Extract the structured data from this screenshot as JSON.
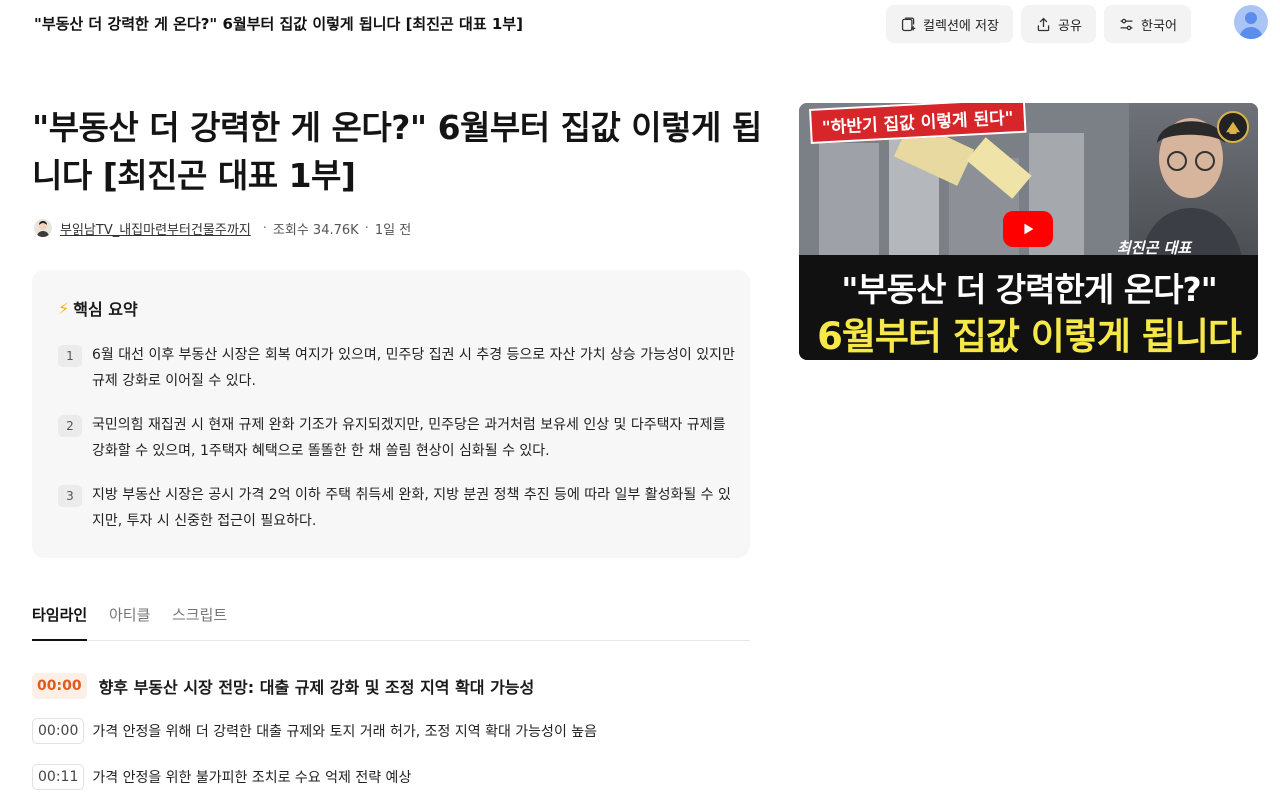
{
  "header": {
    "title": "\"부동산 더 강력한 게 온다?\" 6월부터 집값 이렇게 됩니다 [최진곤 대표 1부]",
    "save_label": "컬렉션에 저장",
    "share_label": "공유",
    "language_label": "한국어"
  },
  "video": {
    "title": "\"부동산 더 강력한 게 온다?\" 6월부터 집값 이렇게 됩니다 [최진곤 대표 1부]",
    "channel": "부읽남TV_내집마련부터건물주까지",
    "views": "조회수 34.76K",
    "age": "1일 전"
  },
  "thumbnail": {
    "tag": "\"하반기 집값 이렇게 된다\"",
    "name": "최진곤 대표",
    "line1": "\"부동산 더 강력한게 온다?\"",
    "line2": "6월부터 집값 이렇게 됩니다",
    "logo": "부읽남 TV"
  },
  "summary": {
    "heading": "핵심 요약",
    "items": [
      {
        "num": "1",
        "text": "6월 대선 이후 부동산 시장은 회복 여지가 있으며, 민주당 집권 시 추경 등으로 자산 가치 상승 가능성이 있지만 규제 강화로 이어질 수 있다."
      },
      {
        "num": "2",
        "text": "국민의힘 재집권 시 현재 규제 완화 기조가 유지되겠지만, 민주당은 과거처럼 보유세 인상 및 다주택자 규제를 강화할 수 있으며, 1주택자 혜택으로 똘똘한 한 채 쏠림 현상이 심화될 수 있다."
      },
      {
        "num": "3",
        "text": "지방 부동산 시장은 공시 가격 2억 이하 주택 취득세 완화, 지방 분권 정책 추진 등에 따라 일부 활성화될 수 있지만, 투자 시 신중한 접근이 필요하다."
      }
    ]
  },
  "tabs": [
    "타임라인",
    "아티클",
    "스크립트"
  ],
  "timeline": {
    "section": {
      "time": "00:00",
      "title": "향후 부동산 시장 전망: 대출 규제 강화 및 조정 지역 확대 가능성"
    },
    "entries": [
      {
        "time": "00:00",
        "text": "가격 안정을 위해 더 강력한 대출 규제와 토지 거래 허가, 조정 지역 확대 가능성이 높음"
      },
      {
        "time": "00:11",
        "text": "가격 안정을 위한 불가피한 조치로 수요 억제 전략 예상"
      }
    ]
  },
  "icons": {
    "save": "collection-add-icon",
    "share": "share-upload-icon",
    "language": "sliders-icon",
    "bolt": "lightning-icon"
  },
  "colors": {
    "accent_orange": "#e05a1a",
    "button_bg": "#f3f3f3",
    "summary_bg": "#f7f7f7",
    "highlight_yellow": "#f7e84a",
    "youtube_red": "#ff0000"
  }
}
